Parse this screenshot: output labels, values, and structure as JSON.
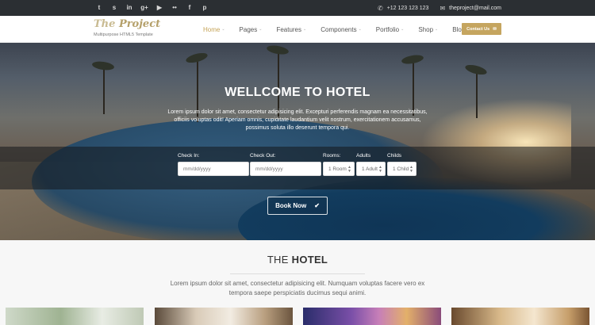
{
  "topbar": {
    "social_icons": [
      {
        "name": "twitter-icon",
        "glyph": "t"
      },
      {
        "name": "skype-icon",
        "glyph": "s"
      },
      {
        "name": "linkedin-icon",
        "glyph": "in"
      },
      {
        "name": "google-plus-icon",
        "glyph": "g+"
      },
      {
        "name": "youtube-icon",
        "glyph": "▶"
      },
      {
        "name": "flickr-icon",
        "glyph": "••"
      },
      {
        "name": "facebook-icon",
        "glyph": "f"
      },
      {
        "name": "pinterest-icon",
        "glyph": "p"
      }
    ],
    "phone": "+12 123 123 123",
    "email": "theproject@mail.com"
  },
  "header": {
    "logo_the": "The ",
    "logo_project": "Project",
    "tagline": "Multipurpose HTML5 Template",
    "nav": [
      "Home",
      "Pages",
      "Features",
      "Components",
      "Portfolio",
      "Shop",
      "Blog"
    ],
    "active_nav": "Home",
    "cta_label": "Contact Us"
  },
  "hero": {
    "title": "WELLCOME TO HOTEL",
    "text": "Lorem ipsum dolor sit amet, consectetur adipisicing elit. Excepturi perferendis magnam ea necessitatibus, officiis voluptas odit! Aperiam omnis, cupiditate laudantium velit nostrum, exercitationem accusamus, possimus soluta illo deserunt tempora qui.",
    "form": {
      "checkin_label": "Check In:",
      "checkin_placeholder": "mm/dd/yyyy",
      "checkout_label": "Check Out:",
      "checkout_placeholder": "mm/dd/yyyy",
      "rooms_label": "Rooms:",
      "rooms_value": "1 Room",
      "adults_label": "Adults",
      "adults_value": "1 Adult",
      "childs_label": "Childs",
      "childs_value": "1 Child"
    },
    "book_label": "Book Now"
  },
  "section": {
    "title_light": "THE ",
    "title_bold": "HOTEL",
    "text": "Lorem ipsum dolor sit amet, consectetur adipisicing elit. Numquam voluptas facere vero ex tempora saepe perspiciatis ducimus sequi animi."
  },
  "colors": {
    "accent": "#c5a55f",
    "topbar": "#2b2f33"
  }
}
